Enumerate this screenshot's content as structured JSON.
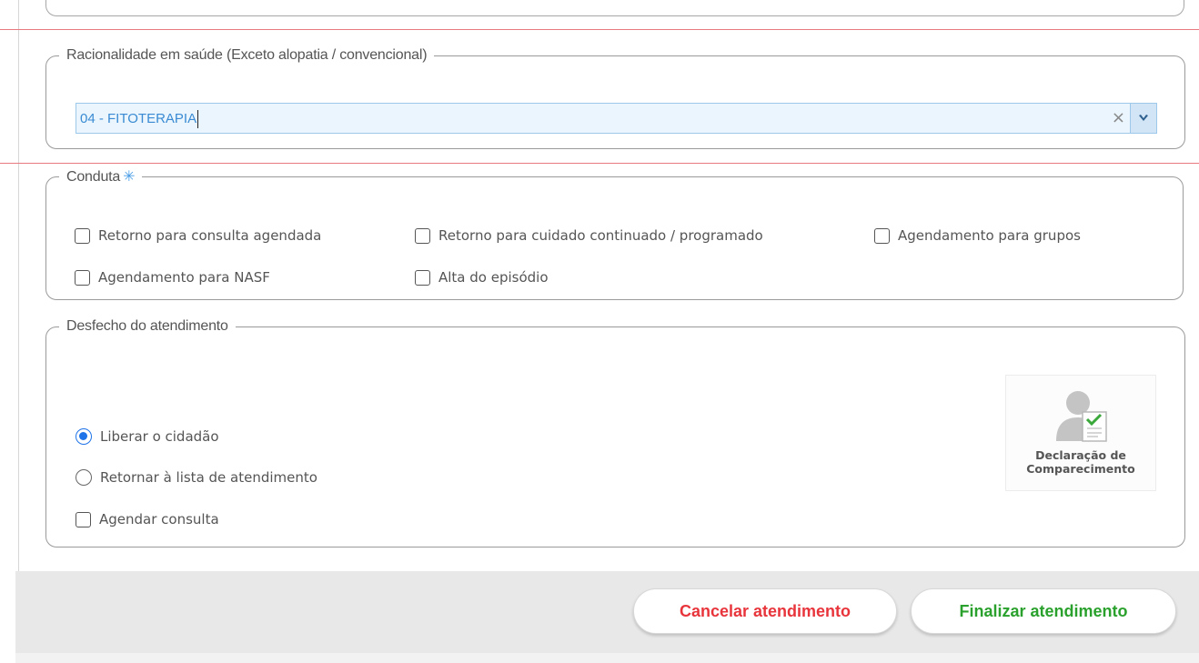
{
  "racionalidade": {
    "legend": "Racionalidade em saúde (Exceto alopatia / convencional)",
    "selected_value": "04 - FITOTERAPIA",
    "clear_symbol": "×"
  },
  "conduta": {
    "legend": "Conduta",
    "required_mark": "✳",
    "options": [
      "Retorno para consulta agendada",
      "Retorno para cuidado continuado / programado",
      "Agendamento para grupos",
      "Agendamento para NASF",
      "Alta do episódio"
    ]
  },
  "desfecho": {
    "legend": "Desfecho do atendimento",
    "radio_liberar": "Liberar o cidadão",
    "radio_retornar": "Retornar à lista de atendimento",
    "checkbox_agendar": "Agendar consulta",
    "selected": "Liberar o cidadão",
    "declaracao_line1": "Declaração de",
    "declaracao_line2": "Comparecimento"
  },
  "footer": {
    "cancel_label": "Cancelar atendimento",
    "finish_label": "Finalizar atendimento"
  },
  "colors": {
    "accent_blue": "#3a8bd3",
    "cancel_red": "#e8353c",
    "finish_green": "#2aa12c"
  },
  "icons": {
    "declaracao": "person-document-check-icon",
    "dropdown": "chevron-down-icon",
    "clear": "close-icon"
  }
}
